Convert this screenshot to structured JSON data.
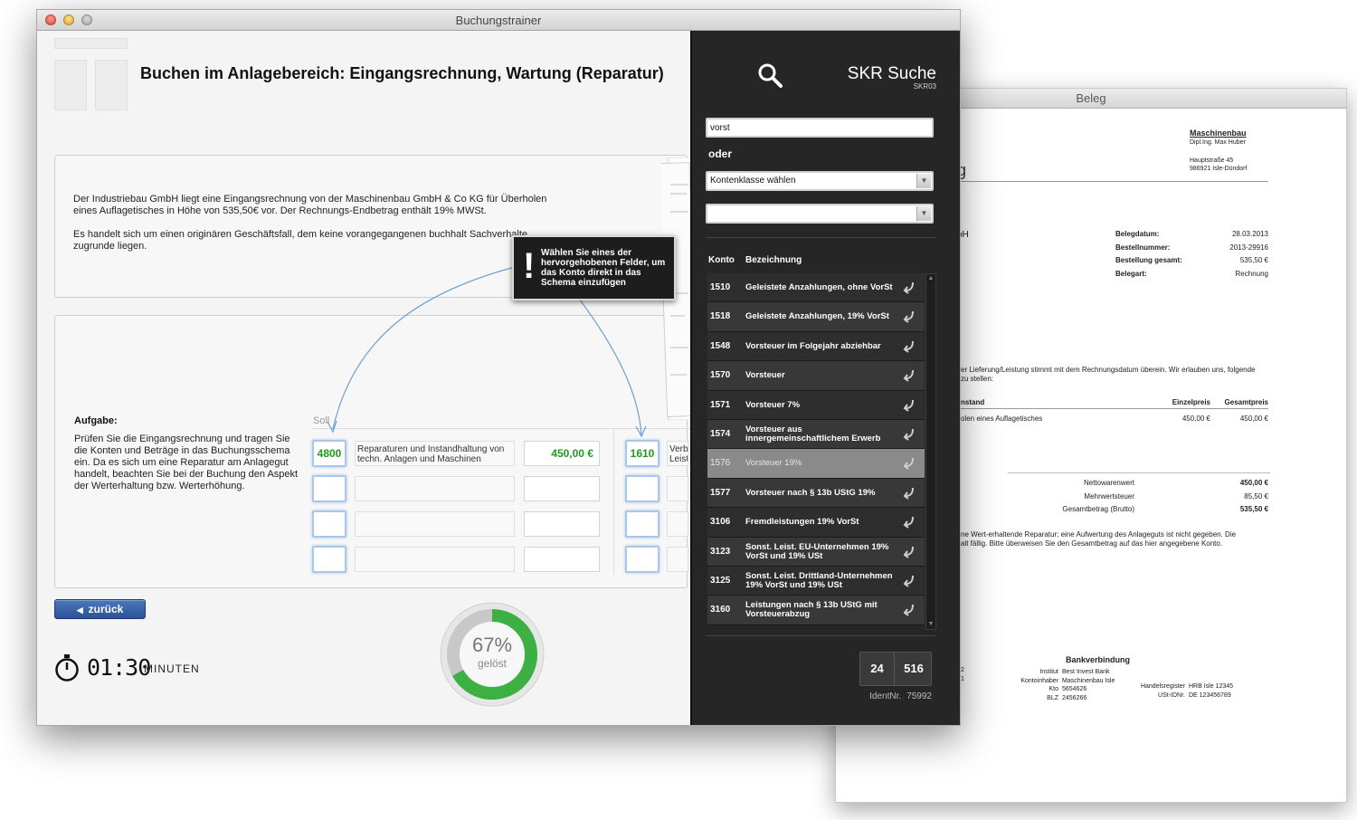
{
  "beleg": {
    "window_title": "Beleg",
    "company": "Maschinenbau",
    "owner": "Dipl.Ing. Max Huber",
    "street": "Hauptstraße 45",
    "city": "986921 Isle-Dündorf",
    "fragment_g": "g",
    "fragment_bh": "bH",
    "meta": [
      {
        "label": "Belegdatum:",
        "value": "28.03.2013"
      },
      {
        "label": "Bestellnummer:",
        "value": "2013-29916"
      },
      {
        "label": "Bestellung gesamt:",
        "value": "535,50 €"
      },
      {
        "label": "Belegart:",
        "value": "Rechnung"
      }
    ],
    "intro_line1": "er Lieferung/Leistung stimmt mit dem Rechnungsdatum überein. Wir erlauben uns, folgende",
    "intro_line2": "zu stellen:",
    "col_item": "nstand",
    "col_unit": "Einzelpreis",
    "col_total": "Gesamtpreis",
    "item_text": "olen eines Auflagetisches",
    "item_unit": "450,00 €",
    "item_total": "450,00 €",
    "totals": [
      {
        "label": "Nettowarenwert",
        "value": "450,00 €",
        "bold": true
      },
      {
        "label": "Mehrwertsteuer",
        "value": "85,50 €",
        "bold": false
      },
      {
        "label": "Gesamtbetrag (Brutto)",
        "value": "535,50 €",
        "bold": true
      }
    ],
    "note_line1": "ne Wert-erhaltende Reparatur; eine Aufwertung des Anlageguts ist nicht gegeben. Die",
    "note_line2": "alt fällig. Bitte überweisen Sie den Gesamtbetrag auf das hier angegebene Konto.",
    "bank_title": "Bankverbindung",
    "bank": [
      {
        "label": "Institut",
        "value": "Best Invest Bank"
      },
      {
        "label": "Kontoinhaber",
        "value": "Maschinenbau Isle"
      },
      {
        "label": "Kto",
        "value": "5654626"
      },
      {
        "label": "BLZ",
        "value": "2456266"
      }
    ],
    "register": [
      {
        "label": "Handelsregister",
        "value": "HRB Isle 12345"
      },
      {
        "label": "USt-IDNr.",
        "value": "DE 123456789"
      }
    ],
    "left_fragments": [
      "2",
      "1"
    ]
  },
  "main": {
    "window_title": "Buchungstrainer",
    "page_title": "Buchen im Anlagebereich: Eingangsrechnung, Wartung (Reparatur)",
    "description_p1": "Der Industriebau GmbH liegt eine Eingangsrechnung von der Maschinenbau GmbH & Co KG für Überholen eines Auflagetisches in Höhe von 535,50€ vor. Der Rechnungs-Endbetrag enthält 19% MWSt.",
    "description_p2": "Es handelt sich um einen originären Geschäftsfall, dem keine vorangegangenen buchhalt Sachverhalte zugrunde liegen.",
    "task_label": "Aufgabe:",
    "task_text": "Prüfen Sie die Eingangsrechnung und tragen Sie die Konten und Beträge in das Buchungsschema ein. Da es sich um eine Reparatur am Anlagegut handelt, beachten Sie bei der Buchung den Aspekt der Werterhaltung bzw. Werterhöhung.",
    "soll_label": "Soll",
    "booking_rows": [
      {
        "soll_account": "4800",
        "soll_text": "Reparaturen und Instandhaltung von techn. Anlagen und Maschinen",
        "amount": "450,00 €",
        "haben_account": "1610",
        "haben_text": "Verb Leist"
      },
      {
        "soll_account": "",
        "soll_text": "",
        "amount": "",
        "haben_account": "",
        "haben_text": ""
      },
      {
        "soll_account": "",
        "soll_text": "",
        "amount": "",
        "haben_account": "",
        "haben_text": ""
      },
      {
        "soll_account": "",
        "soll_text": "",
        "amount": "",
        "haben_account": "",
        "haben_text": ""
      }
    ],
    "tooltip": "Wählen Sie eines der hervorgehobenen Felder, um das Konto direkt in das Schema einzufügen",
    "tooltip_icon": "!",
    "back_label": "zurück",
    "back_arrow": "◀",
    "timer_value": "01:30",
    "timer_unit": "MINUTEN",
    "progress_percent": 67,
    "progress_text": "67%",
    "progress_label": "gelöst",
    "colors": {
      "accent_green": "#1e9a1e",
      "progress_green": "#3cb043",
      "button_blue": "#2c5296",
      "field_highlight": "#a9c7ea"
    }
  },
  "search": {
    "title": "SKR Suche",
    "subtitle": "SKR03",
    "input_value": "vorst",
    "oder": "oder",
    "class_select": "Kontenklasse wählen",
    "second_select": "",
    "col_konto": "Konto",
    "col_bezeichnung": "Bezeichnung",
    "accounts": [
      {
        "num": "1510",
        "name": "Geleistete Anzahlungen, ohne VorSt"
      },
      {
        "num": "1518",
        "name": "Geleistete Anzahlungen, 19% VorSt"
      },
      {
        "num": "1548",
        "name": "Vorsteuer im Folgejahr abziehbar"
      },
      {
        "num": "1570",
        "name": "Vorsteuer"
      },
      {
        "num": "1571",
        "name": "Vorsteuer 7%"
      },
      {
        "num": "1574",
        "name": "Vorsteuer aus innergemeinschaftlichem Erwerb"
      },
      {
        "num": "1576",
        "name": "Vorsteuer 19%"
      },
      {
        "num": "1577",
        "name": "Vorsteuer nach § 13b UStG 19%"
      },
      {
        "num": "3106",
        "name": "Fremdleistungen 19% VorSt"
      },
      {
        "num": "3123",
        "name": "Sonst. Leist. EU-Unternehmen 19% VorSt und 19% USt"
      },
      {
        "num": "3125",
        "name": "Sonst. Leist. Drittland-Unternehmen 19% VorSt und 19% USt"
      },
      {
        "num": "3160",
        "name": "Leistungen nach § 13b UStG mit Vorsteuerabzug"
      }
    ],
    "selected_index": 6,
    "counter_a": "24",
    "counter_b": "516",
    "ident_label": "IdentNr.",
    "ident_value": "75992"
  }
}
